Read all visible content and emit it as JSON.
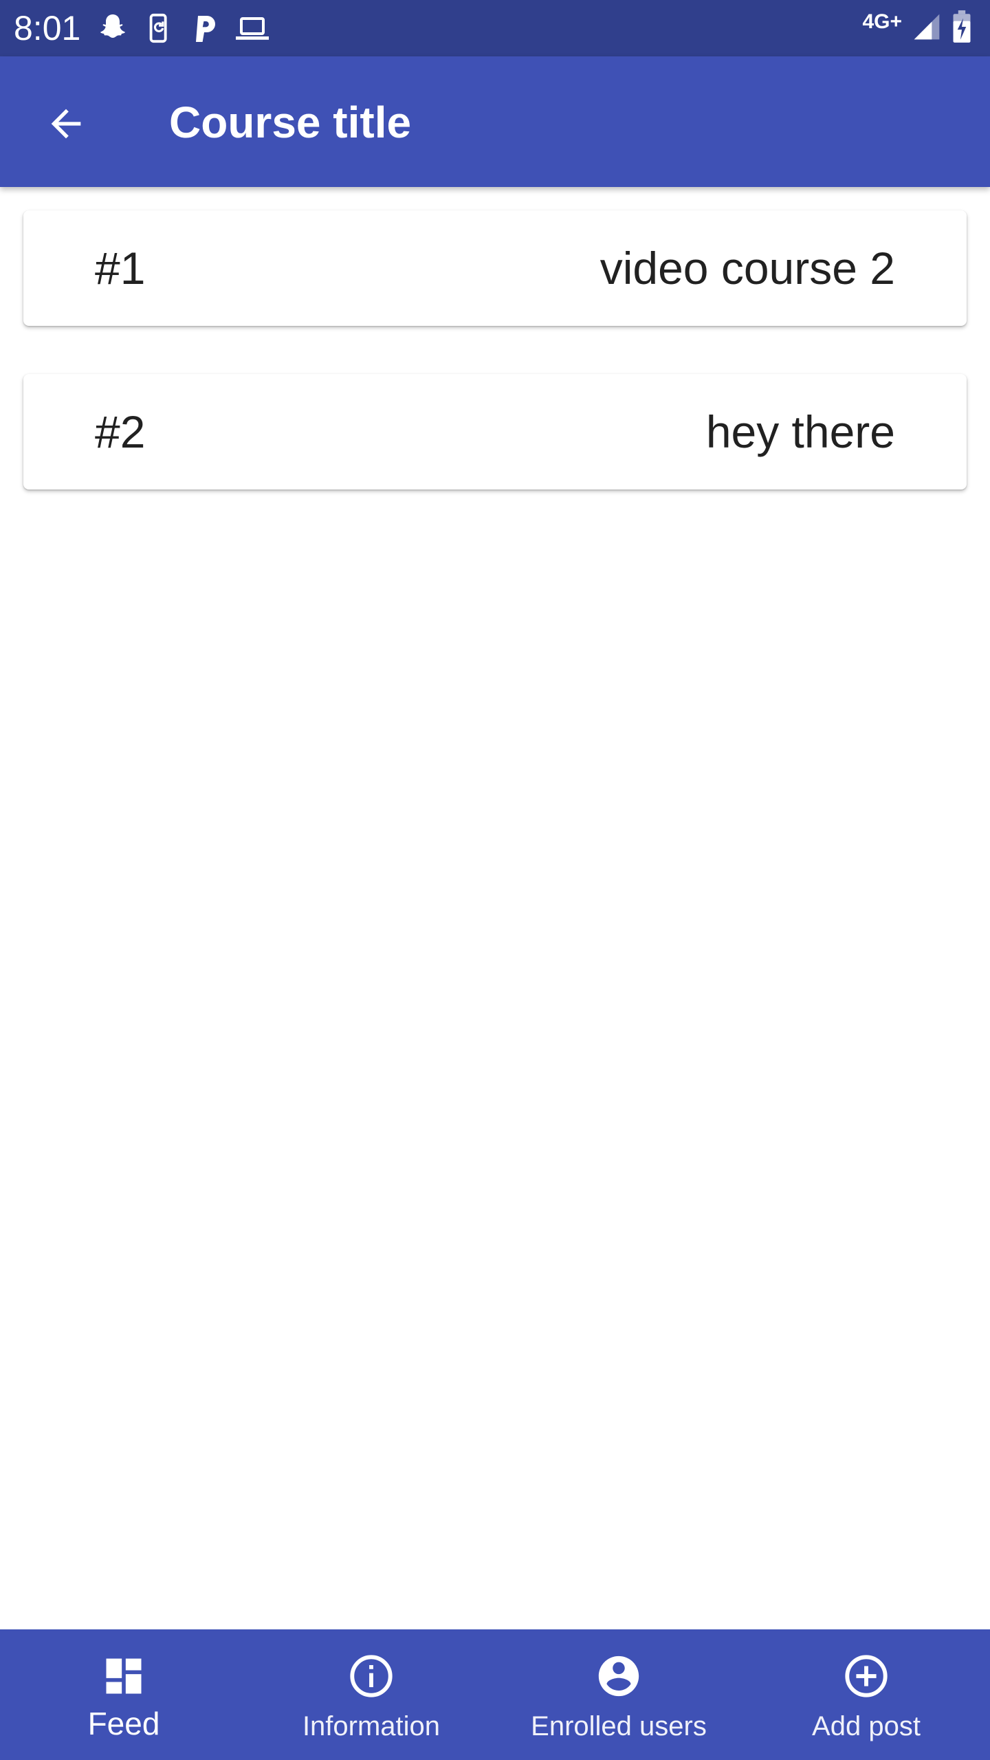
{
  "status_bar": {
    "time": "8:01",
    "network": "4G+",
    "icons_left": [
      "snapchat-icon",
      "phone-sync-icon",
      "p-icon",
      "laptop-icon"
    ],
    "icons_right": [
      "signal-icon",
      "battery-charging-icon"
    ]
  },
  "app_bar": {
    "title": "Course title",
    "back_icon": "arrow-back-icon"
  },
  "feed": {
    "items": [
      {
        "number": "#1",
        "title": "video course 2"
      },
      {
        "number": "#2",
        "title": "hey there"
      }
    ]
  },
  "bottom_nav": {
    "items": [
      {
        "label": "Feed",
        "icon": "dashboard-icon",
        "active": true
      },
      {
        "label": "Information",
        "icon": "info-icon",
        "active": false
      },
      {
        "label": "Enrolled users",
        "icon": "account-circle-icon",
        "active": false
      },
      {
        "label": "Add post",
        "icon": "add-circle-icon",
        "active": false
      }
    ]
  },
  "colors": {
    "status_bar": "#303f8c",
    "primary": "#3f51b5",
    "text_dark": "#212121",
    "on_primary": "#ffffff"
  }
}
